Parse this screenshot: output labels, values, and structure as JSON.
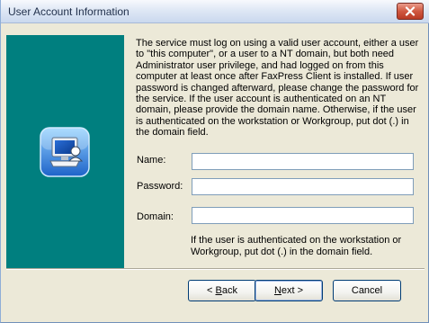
{
  "window": {
    "title": "User Account Information"
  },
  "main": {
    "description": "The service must log on using a valid user account, either a user to \"this computer\", or a user to a NT domain, but both need Administrator user privilege, and had logged on from this computer at least once after FaxPress Client is installed. If user password is changed afterward, please change the password for the service. If the user account is authenticated on an NT domain, please provide the domain name. Otherwise, if the user is authenticated on the workstation or Workgroup, put dot (.) in the domain field.",
    "fields": [
      {
        "label": "Name:",
        "value": ""
      },
      {
        "label": "Password:",
        "value": ""
      },
      {
        "label": "Domain:",
        "value": ""
      }
    ],
    "hint": "If the user is authenticated on the workstation or Workgroup, put dot (.) in the domain field."
  },
  "buttons": {
    "back": {
      "prefix": "< ",
      "mnemonic": "B",
      "rest": "ack"
    },
    "next": {
      "mnemonic": "N",
      "rest": "ext >"
    },
    "cancel": "Cancel"
  },
  "colors": {
    "side_panel": "#007f7f",
    "dialog_bg": "#ece9d8",
    "close_button": "#c6432c"
  },
  "icons": {
    "close": "close-icon",
    "app": "computer-user-icon"
  }
}
